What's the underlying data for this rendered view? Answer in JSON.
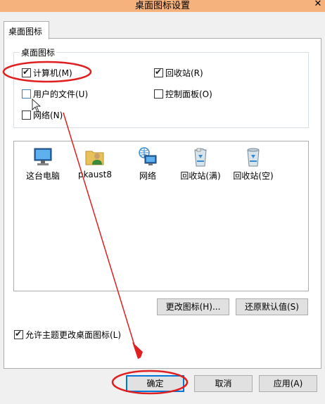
{
  "window": {
    "title": "桌面图标设置"
  },
  "tab": {
    "label": "桌面图标"
  },
  "group": {
    "legend": "桌面图标",
    "items": [
      {
        "label": "计算机(M)",
        "checked": true
      },
      {
        "label": "回收站(R)",
        "checked": true
      },
      {
        "label": "用户的文件(U)",
        "checked": false
      },
      {
        "label": "控制面板(O)",
        "checked": false
      },
      {
        "label": "网络(N)",
        "checked": false
      }
    ]
  },
  "icons": [
    {
      "label": "这台电脑",
      "icon": "computer-icon"
    },
    {
      "label": "pkaust8",
      "icon": "user-folder-icon"
    },
    {
      "label": "网络",
      "icon": "network-icon"
    },
    {
      "label": "回收站(满)",
      "icon": "recycle-bin-full-icon"
    },
    {
      "label": "回收站(空)",
      "icon": "recycle-bin-empty-icon"
    }
  ],
  "buttons": {
    "change_icon": "更改图标(H)...",
    "restore_default": "还原默认值(S)",
    "ok": "确定",
    "cancel": "取消",
    "apply": "应用(A)"
  },
  "theme_checkbox": {
    "label": "允许主题更改桌面图标(L)",
    "checked": true
  },
  "colors": {
    "annotation": "#e02020",
    "title_bar": "#f6b27c",
    "accent": "#0078d7"
  }
}
